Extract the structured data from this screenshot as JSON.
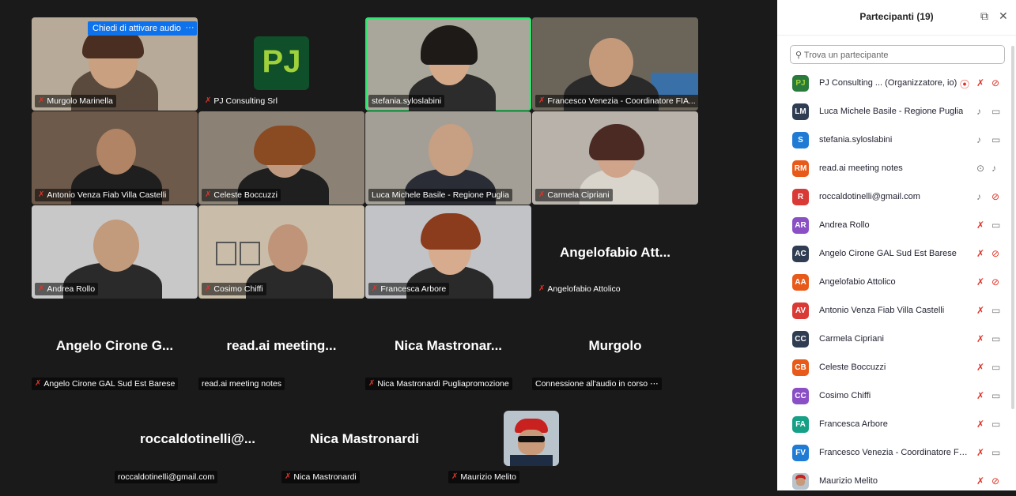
{
  "gallery": {
    "audio_request": "Chiedi di attivare audio",
    "audio_request_more": "···",
    "tiles": {
      "murgolo_marinella": "Murgolo Marinella",
      "pj_consulting": "PJ Consulting Srl",
      "stefania": "stefania.syloslabini",
      "francesco": "Francesco Venezia - Coordinatore FIA...",
      "antonio": "Antonio Venza Fiab Villa Castelli",
      "celeste": "Celeste Boccuzzi",
      "luca": "Luca Michele Basile - Regione Puglia",
      "carmela": "Carmela Cipriani",
      "andrea": "Andrea Rollo",
      "cosimo": "Cosimo Chiffi",
      "francesca": "Francesca Arbore",
      "angelofabio_big": "Angelofabio Att...",
      "angelofabio": "Angelofabio Attolico",
      "angelo_big": "Angelo Cirone G...",
      "angelo": "Angelo Cirone GAL Sud Est Barese",
      "readai_big": "read.ai meeting...",
      "readai": "read.ai meeting notes",
      "nica_pp_big": "Nica Mastronar...",
      "nica_pp": "Nica Mastronardi Pugliapromozione",
      "murgolo_big": "Murgolo",
      "murgolo_audio": "Connessione all'audio in corso",
      "rocca_big": "roccaldotinelli@...",
      "rocca": "roccaldotinelli@gmail.com",
      "nica_big": "Nica Mastronardi",
      "nica": "Nica Mastronardi",
      "maurizio": "Maurizio Melito"
    },
    "pj_logo_text": "PJ"
  },
  "panel": {
    "title": "Partecipanti (19)",
    "search_placeholder": "Trova un partecipante",
    "participants": [
      {
        "initials": "PJ",
        "name": "PJ Consulting ...  (Organizzatore, io)",
        "color": "#2a7a3c"
      },
      {
        "initials": "LM",
        "name": "Luca Michele Basile - Regione Puglia",
        "color": "#2f3d52"
      },
      {
        "initials": "S",
        "name": "stefania.syloslabini",
        "color": "#1f7bd4"
      },
      {
        "initials": "RM",
        "name": "read.ai meeting notes",
        "color": "#e85a1a"
      },
      {
        "initials": "R",
        "name": "roccaldotinelli@gmail.com",
        "color": "#d93a35"
      },
      {
        "initials": "AR",
        "name": "Andrea Rollo",
        "color": "#8a4fc4"
      },
      {
        "initials": "AC",
        "name": "Angelo Cirone GAL Sud Est Barese",
        "color": "#2f3d52"
      },
      {
        "initials": "AA",
        "name": "Angelofabio Attolico",
        "color": "#e85a1a"
      },
      {
        "initials": "AV",
        "name": "Antonio Venza Fiab Villa Castelli",
        "color": "#d93a35"
      },
      {
        "initials": "CC",
        "name": "Carmela Cipriani",
        "color": "#2f3d52"
      },
      {
        "initials": "CB",
        "name": "Celeste Boccuzzi",
        "color": "#e85a1a"
      },
      {
        "initials": "CC",
        "name": "Cosimo Chiffi",
        "color": "#8a4fc4"
      },
      {
        "initials": "FA",
        "name": "Francesca Arbore",
        "color": "#16a085"
      },
      {
        "initials": "FV",
        "name": "Francesco Venezia - Coordinatore FIA...",
        "color": "#1f7bd4"
      },
      {
        "initials": "",
        "name": "Maurizio Melito",
        "color": "#444444"
      }
    ]
  }
}
